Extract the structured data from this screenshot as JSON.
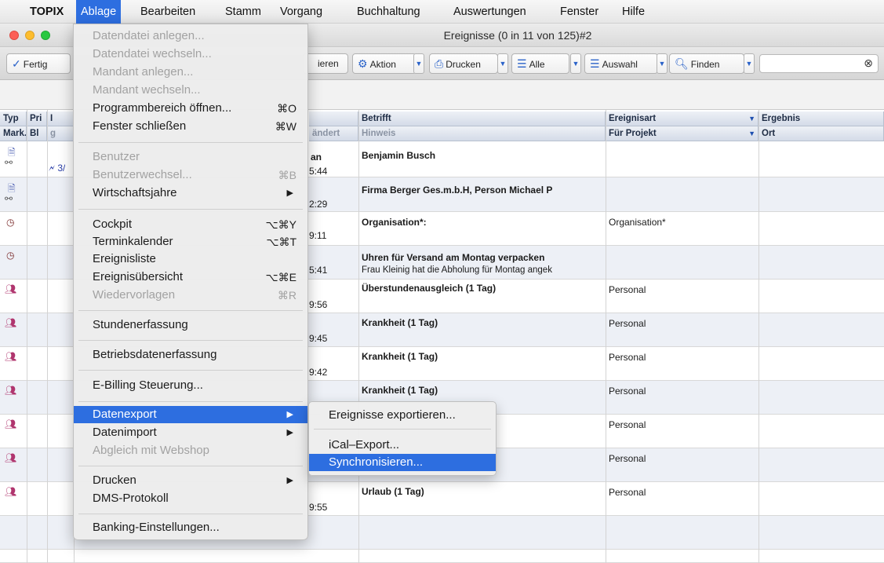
{
  "menubar": {
    "items": [
      "TOPIX",
      "Ablage",
      "Bearbeiten",
      "Stamm",
      "Vorgang",
      "Buchhaltung",
      "Auswertungen",
      "Fenster",
      "Hilfe"
    ]
  },
  "window": {
    "title": "Ereignisse (0 in 11 von 125)#2"
  },
  "toolbar": {
    "fertig": "Fertig",
    "partial": "ieren",
    "aktion": "Aktion",
    "drucken": "Drucken",
    "alle": "Alle",
    "auswahl": "Auswahl",
    "finden": "Finden",
    "search_value": ""
  },
  "table": {
    "headers_row1": {
      "typ": "Typ",
      "pri": "Pri",
      "col3": "I",
      "betrifft": "Betrifft",
      "ereignisart": "Ereignisart",
      "ergebnis": "Ergebnis"
    },
    "headers_row2": {
      "mark": "Mark.",
      "bl": "Bl",
      "col3": "g",
      "geaendert": "ändert",
      "hinweis": "Hinweis",
      "fuer_projekt": "Für Projekt",
      "ort": "Ort"
    },
    "rows": [
      {
        "type_icon": "document-link-icon",
        "pri": "🗲 3/",
        "date_line1": "an",
        "time": "5:44",
        "betrifft": "Benjamin Busch",
        "hinweis": "",
        "ereignisart": ""
      },
      {
        "type_icon": "document-link-icon",
        "pri": "",
        "date_line1": "",
        "time": "2:29",
        "betrifft": "Firma Berger Ges.m.b.H, Person Michael P",
        "hinweis": "",
        "ereignisart": ""
      },
      {
        "type_icon": "clock-icon",
        "pri": "",
        "date_line1": "",
        "time": "9:11",
        "betrifft": "Organisation*:",
        "hinweis": "",
        "ereignisart": "Organisation*"
      },
      {
        "type_icon": "clock-icon",
        "pri": "",
        "date_line1": "",
        "time": "5:41",
        "betrifft": "Uhren für Versand am Montag verpacken",
        "hinweis": "Frau Kleinig hat die Abholung für Montag angek",
        "ereignisart": ""
      },
      {
        "type_icon": "people-icon",
        "pri": "",
        "date_line1": "",
        "time": "9:56",
        "betrifft": "Überstundenausgleich (1 Tag)",
        "hinweis": "",
        "ereignisart": "Personal"
      },
      {
        "type_icon": "people-icon",
        "pri": "",
        "date_line1": "",
        "time": "9:45",
        "betrifft": "Krankheit (1 Tag)",
        "hinweis": "",
        "ereignisart": "Personal"
      },
      {
        "type_icon": "people-icon",
        "pri": "",
        "date_line1": "",
        "time": "9:42",
        "betrifft": "Krankheit (1 Tag)",
        "hinweis": "",
        "ereignisart": "Personal"
      },
      {
        "type_icon": "people-icon",
        "pri": "",
        "date_line1": "",
        "time": "",
        "betrifft": "Krankheit (1 Tag)",
        "hinweis": "",
        "ereignisart": "Personal"
      },
      {
        "type_icon": "people-icon",
        "pri": "",
        "date_line1": "",
        "time": "",
        "betrifft": "",
        "hinweis": "",
        "ereignisart": "Personal"
      },
      {
        "type_icon": "people-icon",
        "pri": "",
        "date_line1": "",
        "time": "",
        "betrifft": "",
        "hinweis": "",
        "ereignisart": "Personal"
      },
      {
        "type_icon": "people-icon",
        "pri": "",
        "date_line1": "",
        "time": "9:55",
        "betrifft": "Urlaub (1 Tag)",
        "hinweis": "",
        "ereignisart": "Personal"
      }
    ]
  },
  "menu": {
    "items": [
      {
        "label": "Datendatei anlegen...",
        "shortcut": "",
        "disabled": true
      },
      {
        "label": "Datendatei wechseln...",
        "shortcut": "",
        "disabled": true
      },
      {
        "label": "Mandant anlegen...",
        "shortcut": "",
        "disabled": true
      },
      {
        "label": "Mandant wechseln...",
        "shortcut": "",
        "disabled": true
      },
      {
        "label": "Programmbereich öffnen...",
        "shortcut": "⌘O",
        "disabled": false
      },
      {
        "label": "Fenster schließen",
        "shortcut": "⌘W",
        "disabled": false
      },
      {
        "label": "Benutzer",
        "shortcut": "",
        "disabled": true
      },
      {
        "label": "Benutzerwechsel...",
        "shortcut": "⌘B",
        "disabled": true
      },
      {
        "label": "Wirtschaftsjahre",
        "shortcut": "▶",
        "disabled": false
      },
      {
        "label": "Cockpit",
        "shortcut": "⌥⌘Y",
        "disabled": false
      },
      {
        "label": "Terminkalender",
        "shortcut": "⌥⌘T",
        "disabled": false
      },
      {
        "label": "Ereignisliste",
        "shortcut": "",
        "disabled": false
      },
      {
        "label": "Ereignisübersicht",
        "shortcut": "⌥⌘E",
        "disabled": false
      },
      {
        "label": "Wiedervorlagen",
        "shortcut": "⌘R",
        "disabled": true
      },
      {
        "label": "Stundenerfassung",
        "shortcut": "",
        "disabled": false
      },
      {
        "label": "Betriebsdatenerfassung",
        "shortcut": "",
        "disabled": false
      },
      {
        "label": "E-Billing Steuerung...",
        "shortcut": "",
        "disabled": false
      },
      {
        "label": "Datenexport",
        "shortcut": "▶",
        "disabled": false
      },
      {
        "label": "Datenimport",
        "shortcut": "▶",
        "disabled": false
      },
      {
        "label": "Abgleich mit Webshop",
        "shortcut": "",
        "disabled": true
      },
      {
        "label": "Drucken",
        "shortcut": "▶",
        "disabled": false
      },
      {
        "label": "DMS-Protokoll",
        "shortcut": "",
        "disabled": false
      },
      {
        "label": "Banking-Einstellungen...",
        "shortcut": "",
        "disabled": false
      }
    ]
  },
  "submenu": {
    "items": [
      "Ereignisse exportieren...",
      "iCal–Export...",
      "Synchronisieren..."
    ]
  }
}
